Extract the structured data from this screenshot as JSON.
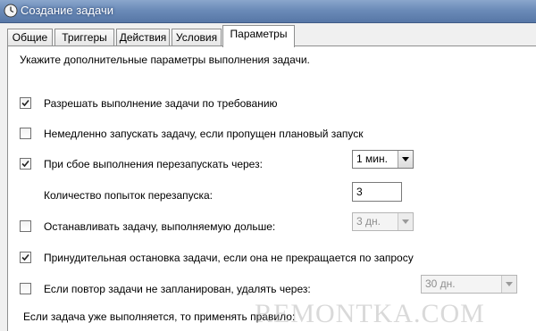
{
  "window": {
    "title": "Создание задачи",
    "title_icon": "clock-icon"
  },
  "tabs": [
    {
      "label": "Общие",
      "active": false
    },
    {
      "label": "Триггеры",
      "active": false
    },
    {
      "label": "Действия",
      "active": false
    },
    {
      "label": "Условия",
      "active": false
    },
    {
      "label": "Параметры",
      "active": true
    }
  ],
  "panel": {
    "intro": "Укажите дополнительные параметры выполнения задачи."
  },
  "options": {
    "allow_on_demand": {
      "label": "Разрешать выполнение задачи по требованию",
      "checked": true
    },
    "run_missed": {
      "label": "Немедленно запускать задачу, если пропущен плановый запуск",
      "checked": false
    },
    "restart_on_fail": {
      "label": "При сбое выполнения перезапускать через:",
      "checked": true,
      "interval": "1 мин."
    },
    "restart_attempts": {
      "label": "Количество попыток перезапуска:",
      "value": "3"
    },
    "stop_if_longer": {
      "label": "Останавливать задачу, выполняемую дольше:",
      "checked": false,
      "duration": "3 дн."
    },
    "force_stop": {
      "label": "Принудительная остановка задачи, если она не прекращается по запросу",
      "checked": true
    },
    "delete_if_not_scheduled": {
      "label": "Если повтор задачи не запланирован, удалять через:",
      "checked": false,
      "duration": "30 дн."
    }
  },
  "footer": {
    "rule_label": "Если задача уже выполняется, то применять правило:"
  },
  "watermark": "REMONTKA.COM",
  "colors": {
    "titlebar": "#6b8bb8",
    "title_text": "#ffffff",
    "panel_bg": "#ffffff",
    "window_bg": "#f0f0f0"
  }
}
